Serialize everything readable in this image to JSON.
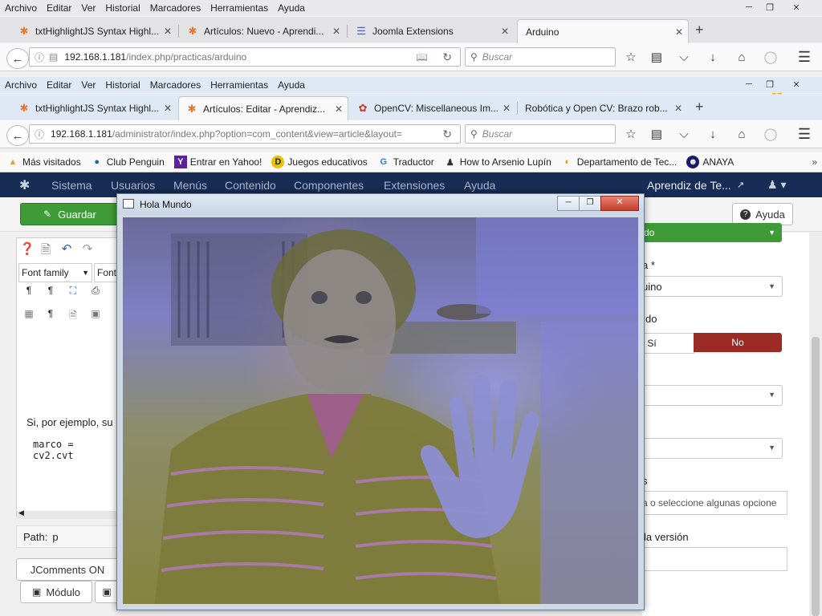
{
  "outer_menu": [
    "Archivo",
    "Editar",
    "Ver",
    "Historial",
    "Marcadores",
    "Herramientas",
    "Ayuda"
  ],
  "outer_tabs": [
    {
      "title": "txtHighlightJS Syntax Highl...",
      "icon": "joomla-icon"
    },
    {
      "title": "Artículos: Nuevo - Aprendi...",
      "icon": "joomla-icon"
    },
    {
      "title": "Joomla Extensions",
      "icon": "page-icon"
    },
    {
      "title": "Arduino",
      "icon": "none"
    }
  ],
  "outer_url": {
    "host": "192.168.1.181",
    "path": "/index.php/practicas/arduino"
  },
  "search_placeholder": "Buscar",
  "outer_badge": "1",
  "inner_menu": [
    "Archivo",
    "Editar",
    "Ver",
    "Historial",
    "Marcadores",
    "Herramientas",
    "Ayuda"
  ],
  "inner_tabs": [
    {
      "title": "txtHighlightJS Syntax Highl...",
      "icon": "joomla-icon"
    },
    {
      "title": "Artículos: Editar - Aprendiz...",
      "icon": "joomla-icon"
    },
    {
      "title": "OpenCV: Miscellaneous Im...",
      "icon": "opencv-icon"
    },
    {
      "title": "Robótica y Open CV: Brazo rob...",
      "icon": "none"
    }
  ],
  "inner_url": {
    "host": "192.168.1.181",
    "path": "/administrator/index.php?option=com_content&view=article&layout="
  },
  "bookmarks": [
    "Más visitados",
    "Club Penguin",
    "Entrar en Yahoo!",
    "Juegos educativos",
    "Traductor",
    "How to Arsenio Lupín",
    "Departamento de Tec...",
    "ANAYA"
  ],
  "joomla_menu": [
    "Sistema",
    "Usuarios",
    "Menús",
    "Contenido",
    "Componentes",
    "Extensiones",
    "Ayuda"
  ],
  "site_name": "Aprendiz de Te...",
  "toolbar": {
    "save": "Guardar",
    "help": "Ayuda"
  },
  "editor": {
    "font_family": "Font family",
    "font_size_partial": "Font",
    "text_line": "Si, por ejemplo, su",
    "code_line": "marco = cv2.cvt",
    "path_label": "Path:",
    "path_value": "p"
  },
  "buttons": {
    "jcomments": "JComments ON",
    "modulo": "Módulo"
  },
  "right_panel": {
    "status_partial": "do",
    "category_label_partial": "a *",
    "category_value_partial": "uino",
    "featured_label_partial": "do",
    "yes": "Sí",
    "no": "No",
    "tags_label_partial": "s",
    "tags_placeholder_partial": "a o seleccione algunas opcione",
    "version_label_partial": "la versión"
  },
  "video_window": {
    "title": "Hola Mundo"
  },
  "colors": {
    "joomla_nav": "#182d56",
    "save_green": "#3e9b38",
    "no_red": "#9b2a24",
    "status_green": "#3e9b38"
  }
}
